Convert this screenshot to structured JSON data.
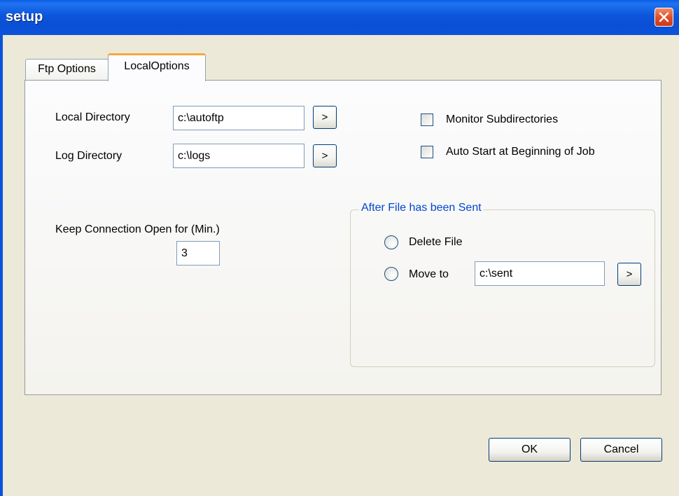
{
  "window": {
    "title": "setup"
  },
  "tabs": [
    {
      "label": "Ftp Options",
      "active": false
    },
    {
      "label": "LocalOptions",
      "active": true
    }
  ],
  "local": {
    "local_directory_label": "Local Directory",
    "local_directory_value": "c:\\autoftp",
    "log_directory_label": "Log Directory",
    "log_directory_value": "c:\\logs",
    "browse_label": ">",
    "keep_connection_label": "Keep Connection Open for (Min.)",
    "keep_connection_value": "3",
    "monitor_subdirs_label": "Monitor Subdirectories",
    "monitor_subdirs_checked": false,
    "auto_start_label": "Auto Start at Beginning of Job",
    "auto_start_checked": false
  },
  "after_sent": {
    "legend": "After File has been Sent",
    "delete_label": "Delete File",
    "move_label": "Move to",
    "move_value": "c:\\sent"
  },
  "footer": {
    "ok_label": "OK",
    "cancel_label": "Cancel"
  },
  "colors": {
    "titlebar": "#0a4fd3",
    "close": "#e0502a",
    "group_legend": "#0046d5",
    "tab_highlight": "#f7a93c"
  }
}
